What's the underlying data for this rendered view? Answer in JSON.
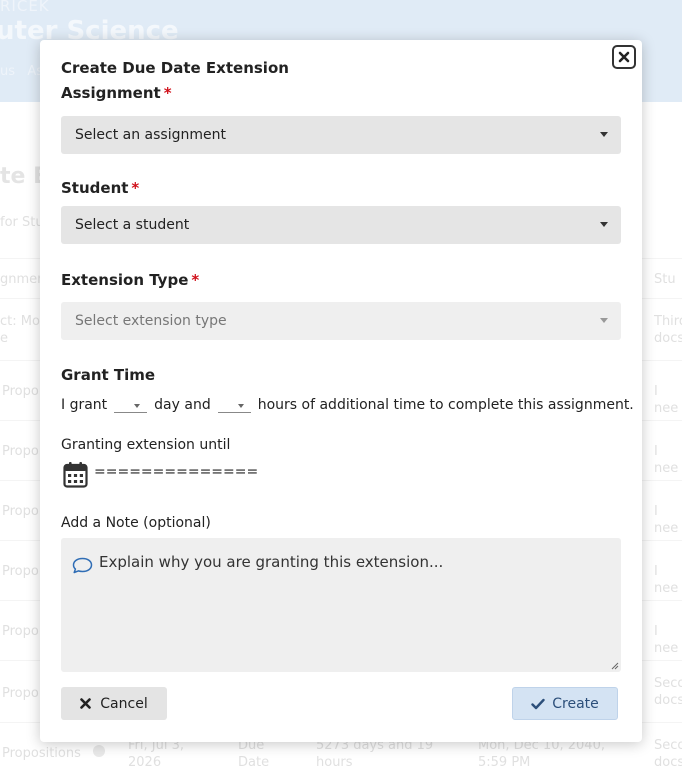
{
  "background": {
    "header_sub": "RICEK",
    "header_title": "uter Science",
    "nav": "us   As",
    "heading": "te E",
    "filter": "for Stu",
    "rows": [
      {
        "a": "gnmen",
        "z": "Stu"
      },
      {
        "a": "ct: Mo\ne",
        "z": "Third\ndocs"
      },
      {
        "a": "Propo",
        "z": "I nee"
      },
      {
        "a": "Propo",
        "z": "I nee"
      },
      {
        "a": "Propo",
        "z": "I nee"
      },
      {
        "a": "Propo",
        "z": "I nee"
      },
      {
        "a": "Propo",
        "z": "I nee"
      },
      {
        "a": "Propo",
        "z": "Seco\ndocs"
      },
      {
        "a": "Propositions",
        "b": "Fri, Jul 3,\n2026",
        "c": "Due\nDate",
        "d": "5273 days and 19\nhours",
        "e": "Mon, Dec 10, 2040,\n5:59 PM",
        "z": "Seco\ndocs"
      }
    ]
  },
  "modal": {
    "title": "Create Due Date Extension",
    "close_icon": "close-icon",
    "assignment": {
      "label": "Assignment",
      "required_mark": "*",
      "placeholder": "Select an assignment"
    },
    "student": {
      "label": "Student",
      "required_mark": "*",
      "placeholder": "Select a student"
    },
    "extension_type": {
      "label": "Extension Type",
      "required_mark": "*",
      "placeholder": "Select extension type"
    },
    "grant_time": {
      "label": "Grant Time",
      "text_before": "I grant",
      "text_middle": "day and",
      "text_after": "hours of additional time to complete this assignment."
    },
    "granting_until": {
      "label": "Granting extension until",
      "value": "=============="
    },
    "note": {
      "label": "Add a Note (optional)",
      "placeholder": "Explain why you are granting this extension..."
    },
    "cancel_label": "Cancel",
    "create_label": "Create",
    "colors": {
      "required": "#d0101a",
      "create_bg": "#d4e3f3",
      "header_bg": "#cfe0f2"
    }
  }
}
